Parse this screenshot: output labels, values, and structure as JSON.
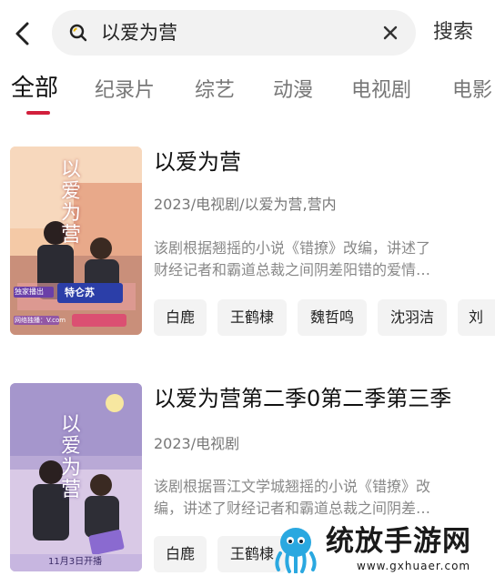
{
  "search": {
    "query": "以爱为营",
    "button_label": "搜索"
  },
  "tabs": [
    {
      "label": "全部",
      "active": true
    },
    {
      "label": "纪录片"
    },
    {
      "label": "综艺"
    },
    {
      "label": "动漫"
    },
    {
      "label": "电视剧"
    },
    {
      "label": "电影"
    }
  ],
  "results": [
    {
      "title": "以爱为营",
      "meta": "2023/电视剧/以爱为营,营内",
      "desc_line1": "该剧根据翘摇的小说《错撩》改编，讲述了",
      "desc_line2": "财经记者和霸道总裁之间阴差阳错的爱情…",
      "cast": [
        "白鹿",
        "王鹤棣",
        "魏哲鸣",
        "沈羽洁",
        "刘"
      ],
      "poster": {
        "title_art": "以爱为营",
        "badge1": "独家播出",
        "badge2": "特仑苏",
        "badge3": "网络独播：V.com"
      }
    },
    {
      "title": "以爱为营第二季0第二季第三季",
      "meta": "2023/电视剧",
      "desc_line1": "该剧根据晋江文学城翘摇的小说《错撩》改",
      "desc_line2": "编，讲述了财经记者和霸道总裁之间阴差…",
      "cast": [
        "白鹿",
        "王鹤棣"
      ],
      "poster": {
        "title_art": "以爱为营",
        "date": "11月3日开播"
      }
    }
  ],
  "watermark": {
    "brand": "统放手游网",
    "site": "www.gxhuaer.com"
  },
  "colors": {
    "accent": "#d21f3c",
    "chip_bg": "#f3f3f3",
    "search_bg": "#f2f2f2"
  }
}
